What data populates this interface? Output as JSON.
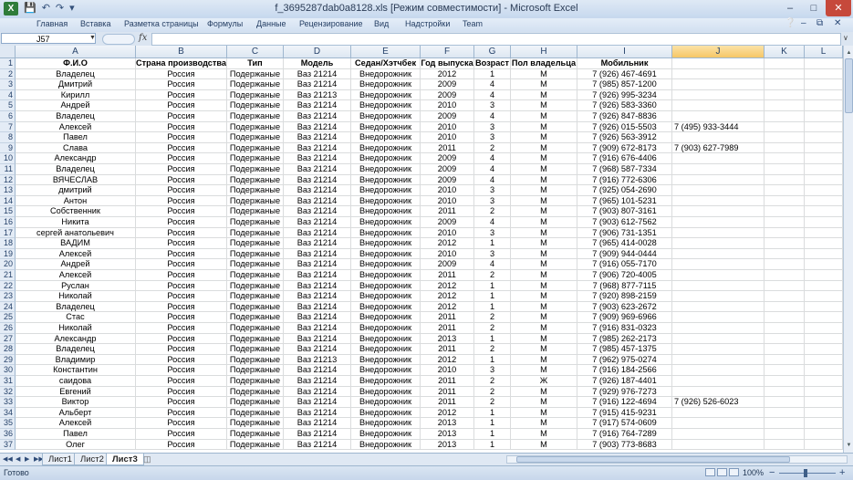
{
  "window": {
    "title": "f_3695287dab0a8128.xls  [Режим совместимости] - Microsoft Excel",
    "app_icon": "excel-icon",
    "qat": [
      "save-icon",
      "undo-icon",
      "redo-icon",
      "customize-icon"
    ],
    "controls": [
      "minimize-icon",
      "maximize-icon",
      "close-icon"
    ]
  },
  "ribbon": {
    "tabs": [
      "Главная",
      "Вставка",
      "Разметка страницы",
      "Формулы",
      "Данные",
      "Рецензирование",
      "Вид",
      "Надстройки",
      "Team"
    ]
  },
  "formula_bar": {
    "cell_ref": "J57",
    "fx_label": "fx",
    "formula": ""
  },
  "grid": {
    "selected_column": "J",
    "columns": [
      "A",
      "B",
      "C",
      "D",
      "E",
      "F",
      "G",
      "H",
      "I",
      "J",
      "K",
      "L"
    ],
    "header_row": [
      "Ф.И.О",
      "Страна производства",
      "Тип",
      "Модель",
      "Седан/Хэтчбек",
      "Год выпуска",
      "Возраст",
      "Пол владельца",
      "Мобильник"
    ],
    "rows": [
      {
        "n": "2",
        "a": "Владелец",
        "b": "Россия",
        "c": "Подержаные",
        "d": "Ваз 21214",
        "e": "Внедорожник",
        "f": "2012",
        "g": "1",
        "h": "М",
        "i": "7 (926) 467-4691",
        "j": ""
      },
      {
        "n": "3",
        "a": "Дмитрий",
        "b": "Россия",
        "c": "Подержаные",
        "d": "Ваз 21214",
        "e": "Внедорожник",
        "f": "2009",
        "g": "4",
        "h": "М",
        "i": "7 (985) 857-1200",
        "j": ""
      },
      {
        "n": "4",
        "a": "Кирилл",
        "b": "Россия",
        "c": "Подержаные",
        "d": "Ваз 21213",
        "e": "Внедорожник",
        "f": "2009",
        "g": "4",
        "h": "М",
        "i": "7 (926) 995-3234",
        "j": ""
      },
      {
        "n": "5",
        "a": "Андрей",
        "b": "Россия",
        "c": "Подержаные",
        "d": "Ваз 21214",
        "e": "Внедорожник",
        "f": "2010",
        "g": "3",
        "h": "М",
        "i": "7 (926) 583-3360",
        "j": ""
      },
      {
        "n": "6",
        "a": "Владелец",
        "b": "Россия",
        "c": "Подержаные",
        "d": "Ваз 21214",
        "e": "Внедорожник",
        "f": "2009",
        "g": "4",
        "h": "М",
        "i": "7 (926) 847-8836",
        "j": ""
      },
      {
        "n": "7",
        "a": "Алексей",
        "b": "Россия",
        "c": "Подержаные",
        "d": "Ваз 21214",
        "e": "Внедорожник",
        "f": "2010",
        "g": "3",
        "h": "М",
        "i": "7 (926) 015-5503",
        "j": "7 (495) 933-3444"
      },
      {
        "n": "8",
        "a": "Павел",
        "b": "Россия",
        "c": "Подержаные",
        "d": "Ваз 21214",
        "e": "Внедорожник",
        "f": "2010",
        "g": "3",
        "h": "М",
        "i": "7 (926) 563-3912",
        "j": ""
      },
      {
        "n": "9",
        "a": "Слава",
        "b": "Россия",
        "c": "Подержаные",
        "d": "Ваз 21214",
        "e": "Внедорожник",
        "f": "2011",
        "g": "2",
        "h": "М",
        "i": "7 (909) 672-8173",
        "j": "7 (903) 627-7989"
      },
      {
        "n": "10",
        "a": "Александр",
        "b": "Россия",
        "c": "Подержаные",
        "d": "Ваз 21214",
        "e": "Внедорожник",
        "f": "2009",
        "g": "4",
        "h": "М",
        "i": "7 (916) 676-4406",
        "j": ""
      },
      {
        "n": "11",
        "a": "Владелец",
        "b": "Россия",
        "c": "Подержаные",
        "d": "Ваз 21214",
        "e": "Внедорожник",
        "f": "2009",
        "g": "4",
        "h": "М",
        "i": "7 (968) 587-7334",
        "j": ""
      },
      {
        "n": "12",
        "a": "ВЯЧЕСЛАВ",
        "b": "Россия",
        "c": "Подержаные",
        "d": "Ваз 21214",
        "e": "Внедорожник",
        "f": "2009",
        "g": "4",
        "h": "М",
        "i": "7 (916) 772-6306",
        "j": ""
      },
      {
        "n": "13",
        "a": "дмитрий",
        "b": "Россия",
        "c": "Подержаные",
        "d": "Ваз 21214",
        "e": "Внедорожник",
        "f": "2010",
        "g": "3",
        "h": "М",
        "i": "7 (925) 054-2690",
        "j": ""
      },
      {
        "n": "14",
        "a": "Антон",
        "b": "Россия",
        "c": "Подержаные",
        "d": "Ваз 21214",
        "e": "Внедорожник",
        "f": "2010",
        "g": "3",
        "h": "М",
        "i": "7 (965) 101-5231",
        "j": ""
      },
      {
        "n": "15",
        "a": "Собственник",
        "b": "Россия",
        "c": "Подержаные",
        "d": "Ваз 21214",
        "e": "Внедорожник",
        "f": "2011",
        "g": "2",
        "h": "М",
        "i": "7 (903) 807-3161",
        "j": ""
      },
      {
        "n": "16",
        "a": "Никита",
        "b": "Россия",
        "c": "Подержаные",
        "d": "Ваз 21214",
        "e": "Внедорожник",
        "f": "2009",
        "g": "4",
        "h": "М",
        "i": "7 (903) 612-7562",
        "j": ""
      },
      {
        "n": "17",
        "a": "сергей анатольевич",
        "b": "Россия",
        "c": "Подержаные",
        "d": "Ваз 21214",
        "e": "Внедорожник",
        "f": "2010",
        "g": "3",
        "h": "М",
        "i": "7 (906) 731-1351",
        "j": ""
      },
      {
        "n": "18",
        "a": "ВАДИМ",
        "b": "Россия",
        "c": "Подержаные",
        "d": "Ваз 21214",
        "e": "Внедорожник",
        "f": "2012",
        "g": "1",
        "h": "М",
        "i": "7 (965) 414-0028",
        "j": ""
      },
      {
        "n": "19",
        "a": "Алексей",
        "b": "Россия",
        "c": "Подержаные",
        "d": "Ваз 21214",
        "e": "Внедорожник",
        "f": "2010",
        "g": "3",
        "h": "М",
        "i": "7 (909) 944-0444",
        "j": ""
      },
      {
        "n": "20",
        "a": "Андрей",
        "b": "Россия",
        "c": "Подержаные",
        "d": "Ваз 21214",
        "e": "Внедорожник",
        "f": "2009",
        "g": "4",
        "h": "М",
        "i": "7 (916) 055-7170",
        "j": ""
      },
      {
        "n": "21",
        "a": "Алексей",
        "b": "Россия",
        "c": "Подержаные",
        "d": "Ваз 21214",
        "e": "Внедорожник",
        "f": "2011",
        "g": "2",
        "h": "М",
        "i": "7 (906) 720-4005",
        "j": ""
      },
      {
        "n": "22",
        "a": "Руслан",
        "b": "Россия",
        "c": "Подержаные",
        "d": "Ваз 21214",
        "e": "Внедорожник",
        "f": "2012",
        "g": "1",
        "h": "М",
        "i": "7 (968) 877-7115",
        "j": ""
      },
      {
        "n": "23",
        "a": "Николай",
        "b": "Россия",
        "c": "Подержаные",
        "d": "Ваз 21214",
        "e": "Внедорожник",
        "f": "2012",
        "g": "1",
        "h": "М",
        "i": "7 (920) 898-2159",
        "j": ""
      },
      {
        "n": "24",
        "a": "Владелец",
        "b": "Россия",
        "c": "Подержаные",
        "d": "Ваз 21214",
        "e": "Внедорожник",
        "f": "2012",
        "g": "1",
        "h": "М",
        "i": "7 (903) 623-2672",
        "j": ""
      },
      {
        "n": "25",
        "a": "Стас",
        "b": "Россия",
        "c": "Подержаные",
        "d": "Ваз 21214",
        "e": "Внедорожник",
        "f": "2011",
        "g": "2",
        "h": "М",
        "i": "7 (909) 969-6966",
        "j": ""
      },
      {
        "n": "26",
        "a": "Николай",
        "b": "Россия",
        "c": "Подержаные",
        "d": "Ваз 21214",
        "e": "Внедорожник",
        "f": "2011",
        "g": "2",
        "h": "М",
        "i": "7 (916) 831-0323",
        "j": ""
      },
      {
        "n": "27",
        "a": "Александр",
        "b": "Россия",
        "c": "Подержаные",
        "d": "Ваз 21214",
        "e": "Внедорожник",
        "f": "2013",
        "g": "1",
        "h": "М",
        "i": "7 (985) 262-2173",
        "j": ""
      },
      {
        "n": "28",
        "a": "Владелец",
        "b": "Россия",
        "c": "Подержаные",
        "d": "Ваз 21214",
        "e": "Внедорожник",
        "f": "2011",
        "g": "2",
        "h": "М",
        "i": "7 (985) 457-1375",
        "j": ""
      },
      {
        "n": "29",
        "a": "Владимир",
        "b": "Россия",
        "c": "Подержаные",
        "d": "Ваз 21213",
        "e": "Внедорожник",
        "f": "2012",
        "g": "1",
        "h": "М",
        "i": "7 (962) 975-0274",
        "j": ""
      },
      {
        "n": "30",
        "a": "Константин",
        "b": "Россия",
        "c": "Подержаные",
        "d": "Ваз 21214",
        "e": "Внедорожник",
        "f": "2010",
        "g": "3",
        "h": "М",
        "i": "7 (916) 184-2566",
        "j": ""
      },
      {
        "n": "31",
        "a": "саидова",
        "b": "Россия",
        "c": "Подержаные",
        "d": "Ваз 21214",
        "e": "Внедорожник",
        "f": "2011",
        "g": "2",
        "h": "Ж",
        "i": "7 (926) 187-4401",
        "j": ""
      },
      {
        "n": "32",
        "a": "Евгений",
        "b": "Россия",
        "c": "Подержаные",
        "d": "Ваз 21214",
        "e": "Внедорожник",
        "f": "2011",
        "g": "2",
        "h": "М",
        "i": "7 (929) 976-7273",
        "j": ""
      },
      {
        "n": "33",
        "a": "Виктор",
        "b": "Россия",
        "c": "Подержаные",
        "d": "Ваз 21214",
        "e": "Внедорожник",
        "f": "2011",
        "g": "2",
        "h": "М",
        "i": "7 (916) 122-4694",
        "j": "7 (926) 526-6023"
      },
      {
        "n": "34",
        "a": "Альберт",
        "b": "Россия",
        "c": "Подержаные",
        "d": "Ваз 21214",
        "e": "Внедорожник",
        "f": "2012",
        "g": "1",
        "h": "М",
        "i": "7 (915) 415-9231",
        "j": ""
      },
      {
        "n": "35",
        "a": "Алексей",
        "b": "Россия",
        "c": "Подержаные",
        "d": "Ваз 21214",
        "e": "Внедорожник",
        "f": "2013",
        "g": "1",
        "h": "М",
        "i": "7 (917) 574-0609",
        "j": ""
      },
      {
        "n": "36",
        "a": "Павел",
        "b": "Россия",
        "c": "Подержаные",
        "d": "Ваз 21214",
        "e": "Внедорожник",
        "f": "2013",
        "g": "1",
        "h": "М",
        "i": "7 (916) 764-7289",
        "j": ""
      },
      {
        "n": "37",
        "a": "Олег",
        "b": "Россия",
        "c": "Подержаные",
        "d": "Ваз 21214",
        "e": "Внедорожник",
        "f": "2013",
        "g": "1",
        "h": "М",
        "i": "7 (903) 773-8683",
        "j": ""
      }
    ]
  },
  "sheets": {
    "tabs": [
      "Лист1",
      "Лист2",
      "Лист3"
    ],
    "active": "Лист3",
    "nav_icons": [
      "first-sheet-icon",
      "prev-sheet-icon",
      "next-sheet-icon",
      "last-sheet-icon"
    ],
    "new_sheet_icon": "insert-sheet-icon"
  },
  "status": {
    "ready": "Готово",
    "zoom": "100%",
    "zoom_minus": "−",
    "zoom_plus": "+"
  },
  "colors": {
    "accent": "#dbe5f1",
    "selected_header": "#f6c766",
    "close_button": "#c6493b"
  }
}
